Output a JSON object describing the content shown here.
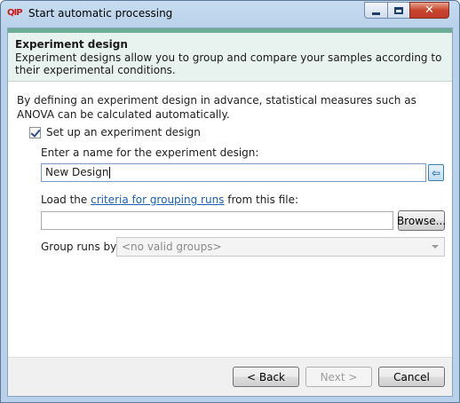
{
  "window": {
    "title": "Start automatic processing",
    "app_icon_text": "QIP",
    "close_glyph": "✕"
  },
  "header": {
    "title": "Experiment design",
    "description": "Experiment designs allow you to group and compare your samples according to their experimental conditions."
  },
  "intro_text": "By defining an experiment design in advance, statistical measures such as ANOVA can be calculated automatically.",
  "setup_checkbox": {
    "label": "Set up an experiment design",
    "checked": true
  },
  "name_field": {
    "label": "Enter a name for the experiment design:",
    "value": "New Design",
    "apply_glyph": "⇦"
  },
  "load": {
    "prefix": "Load the ",
    "link_text": "criteria for grouping runs",
    "suffix": " from this file:",
    "file_value": "",
    "browse_label": "Browse..."
  },
  "group_runs": {
    "label": "Group runs by:",
    "selected": "<no valid groups>"
  },
  "footer": {
    "back_label": "< Back",
    "next_label": "Next >",
    "cancel_label": "Cancel"
  }
}
